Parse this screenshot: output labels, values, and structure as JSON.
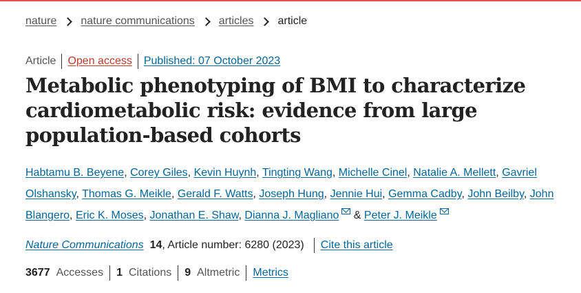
{
  "breadcrumb": {
    "items": [
      "nature",
      "nature communications",
      "articles"
    ],
    "current": "article"
  },
  "meta": {
    "type": "Article",
    "access": "Open access",
    "published": "Published: 07 October 2023"
  },
  "title": "Metabolic phenotyping of BMI to characterize cardiometabolic risk: evidence from large population-based cohorts",
  "authors": [
    "Habtamu B. Beyene",
    "Corey Giles",
    "Kevin Huynh",
    "Tingting Wang",
    "Michelle Cinel",
    "Natalie A. Mellett",
    "Gavriel Olshansky",
    "Thomas G. Meikle",
    "Gerald F. Watts",
    "Joseph Hung",
    "Jennie Hui",
    "Gemma Cadby",
    "John Beilby",
    "John Blangero",
    "Eric K. Moses",
    "Jonathan E. Shaw",
    "Dianna J. Magliano",
    "Peter J. Meikle"
  ],
  "authors_separator": ", ",
  "authors_and": " & ",
  "citation": {
    "journal": "Nature Communications",
    "volume": "14",
    "article_number": ", Article number: 6280 (2023)",
    "cite_link": "Cite this article"
  },
  "metrics": {
    "accesses_count": "3677",
    "accesses_label": "Accesses",
    "citations_count": "1",
    "citations_label": "Citations",
    "altmetric_count": "9",
    "altmetric_label": "Altmetric",
    "metrics_link": "Metrics"
  },
  "colors": {
    "link": "#006699",
    "open_access": "#c0392b",
    "top_border": "#e0564b"
  }
}
